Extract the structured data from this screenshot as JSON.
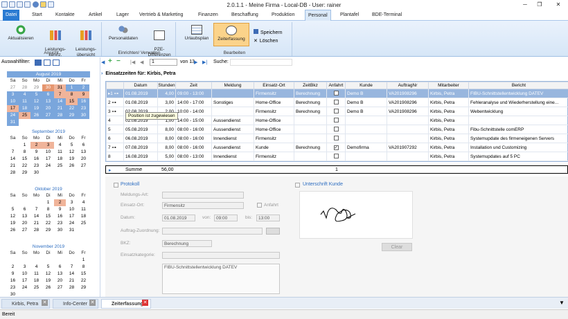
{
  "title_bar": {
    "title": "2.0.1.1 - Meine Firma - Local-DB - User: rainer",
    "minimize": "─",
    "restore": "❐",
    "close": "✕"
  },
  "menu": {
    "items": [
      "Datei",
      "Start",
      "Kontakte",
      "Artikel",
      "Lager",
      "Vertrieb & Marketing",
      "Finanzen",
      "Beschaffung",
      "Produktion",
      "Personal",
      "Plantafel",
      "BDE-Terminal"
    ],
    "active": "Personal"
  },
  "ribbon": {
    "groups": [
      {
        "label": "Ansicht",
        "buttons": [
          "Aktualisieren",
          "Leistungs-\nkennz.",
          "Leistungs-\nübersicht"
        ]
      },
      {
        "label": "Einrichten/ Verwalten",
        "buttons": [
          "Personaldaten",
          "PZE-\nDifferenzen"
        ]
      },
      {
        "label": "Bearbeiten",
        "buttons": [
          "Urlaubsplan",
          "Zeiterfassung"
        ]
      }
    ],
    "small_buttons": [
      "Speichern",
      "Löschen"
    ]
  },
  "filter": {
    "label": "Auswahlfilter:"
  },
  "calendars": [
    {
      "title": "August 2019",
      "weekdays": [
        "Sa",
        "So",
        "Mo",
        "Di",
        "Mi",
        "Do",
        "Fr"
      ],
      "days": [
        "27",
        "28",
        "29",
        "30",
        "31",
        "1",
        "2",
        "3",
        "4",
        "5",
        "6",
        "7",
        "8",
        "9",
        "10",
        "11",
        "12",
        "13",
        "14",
        "15",
        "16",
        "17",
        "18",
        "19",
        "20",
        "21",
        "22",
        "23",
        "24",
        "25",
        "26",
        "27",
        "28",
        "29",
        "30",
        "31"
      ]
    },
    {
      "title": "September 2019",
      "weekdays": [
        "Sa",
        "So",
        "Mo",
        "Di",
        "Mi",
        "Do",
        "Fr"
      ],
      "days": [
        "",
        "1",
        "2",
        "3",
        "4",
        "5",
        "6",
        "7",
        "8",
        "9",
        "10",
        "11",
        "12",
        "13",
        "14",
        "15",
        "16",
        "17",
        "18",
        "19",
        "20",
        "21",
        "22",
        "23",
        "24",
        "25",
        "26",
        "27",
        "28",
        "29",
        "30"
      ]
    },
    {
      "title": "Oktober 2019",
      "weekdays": [
        "Sa",
        "So",
        "Mo",
        "Di",
        "Mi",
        "Do",
        "Fr"
      ],
      "days": [
        "",
        "",
        "",
        "1",
        "2",
        "3",
        "4",
        "5",
        "6",
        "7",
        "8",
        "9",
        "10",
        "11",
        "12",
        "13",
        "14",
        "15",
        "16",
        "17",
        "18",
        "19",
        "20",
        "21",
        "22",
        "23",
        "24",
        "25",
        "26",
        "27",
        "28",
        "29",
        "30",
        "31"
      ]
    },
    {
      "title": "November 2019",
      "weekdays": [
        "Sa",
        "So",
        "Mo",
        "Di",
        "Mi",
        "Do",
        "Fr"
      ],
      "days": [
        "",
        "",
        "",
        "",
        "",
        "",
        "1",
        "2",
        "3",
        "4",
        "5",
        "6",
        "7",
        "8",
        "9",
        "10",
        "11",
        "12",
        "13",
        "14",
        "15",
        "16",
        "17",
        "18",
        "19",
        "20",
        "21",
        "22",
        "23",
        "24",
        "25",
        "26",
        "27",
        "28",
        "29",
        "30"
      ]
    }
  ],
  "navigator": {
    "position": "1",
    "of_label": "von 13",
    "search_label": "Suche:"
  },
  "grid": {
    "caption": "Einsatzzeiten für: Kirbis, Petra",
    "columns": [
      "Datum",
      "Stunden",
      "Zeit",
      "Meldung",
      "Einsatz-Ort",
      "ZeitBkz",
      "Anfahrt",
      "Kunde",
      "AuftragNr",
      "Mitarbeiter",
      "Bericht"
    ],
    "rows": [
      {
        "n": "1",
        "datum": "01.08.2019",
        "stunden": "4,00",
        "zeit": "09:00 - 13:00",
        "meldung": "",
        "ort": "Firmensitz",
        "bkz": "Berechnung",
        "anfahrt": "",
        "kunde": "Demo B",
        "auftrag": "VA201908296",
        "mitarbeiter": "Kirbis, Petra",
        "bericht": "FIBU-Schnittstellentwicklung DATEV"
      },
      {
        "n": "2",
        "datum": "01.08.2019",
        "stunden": "3,00",
        "zeit": "14:00 - 17:00",
        "meldung": "Sonstiges",
        "ort": "Home-Office",
        "bkz": "Berechnung",
        "anfahrt": "",
        "kunde": "Demo B",
        "auftrag": "VA201908296",
        "mitarbeiter": "Kirbis, Petra",
        "bericht": "Fehleranalyse und Wiederherstellung eine..."
      },
      {
        "n": "3",
        "datum": "02.08.2019",
        "stunden": "2,00",
        "zeit": "10:00 - 14:00",
        "meldung": "",
        "ort": "Firmensitz",
        "bkz": "Berechnung",
        "anfahrt": "",
        "kunde": "Demo B",
        "auftrag": "VA201908296",
        "mitarbeiter": "Kirbis, Petra",
        "bericht": "Webentwicklung"
      },
      {
        "n": "4",
        "datum": "02.08.2019",
        "stunden": "1,00",
        "zeit": "14:00 - 15:00",
        "meldung": "Aussendienst",
        "ort": "Home-Office",
        "bkz": "",
        "anfahrt": "",
        "kunde": "",
        "auftrag": "",
        "mitarbeiter": "Kirbis, Petra",
        "bericht": ""
      },
      {
        "n": "5",
        "datum": "05.08.2019",
        "stunden": "8,00",
        "zeit": "08:00 - 16:00",
        "meldung": "Aussendienst",
        "ort": "Home-Office",
        "bkz": "",
        "anfahrt": "",
        "kunde": "",
        "auftrag": "",
        "mitarbeiter": "Kirbis, Petra",
        "bericht": "Fibu-Schnittstelle comERP"
      },
      {
        "n": "6",
        "datum": "06.08.2019",
        "stunden": "8,00",
        "zeit": "08:00 - 16:00",
        "meldung": "Innendienst",
        "ort": "Firmensitz",
        "bkz": "",
        "anfahrt": "",
        "kunde": "",
        "auftrag": "",
        "mitarbeiter": "Kirbis, Petra",
        "bericht": "Systemupdate des firmeneigenen Servers"
      },
      {
        "n": "7",
        "datum": "07.08.2019",
        "stunden": "8,00",
        "zeit": "08:00 - 16:00",
        "meldung": "Aussendienst",
        "ort": "Kunde",
        "bkz": "Berechnung",
        "anfahrt": "✓",
        "kunde": "Demofirma",
        "auftrag": "VA201907292",
        "mitarbeiter": "Kirbis, Petra",
        "bericht": "Installation und Customizing"
      },
      {
        "n": "8",
        "datum": "16.08.2019",
        "stunden": "5,00",
        "zeit": "08:00 - 13:00",
        "meldung": "Innendienst",
        "ort": "Firmensitz",
        "bkz": "",
        "anfahrt": "",
        "kunde": "",
        "auftrag": "",
        "mitarbeiter": "Kirbis, Petra",
        "bericht": "Systemupdates auf 5 PC"
      }
    ],
    "tooltip": "Position ist zugewiesen",
    "sum_label": "Summe",
    "sum_hours": "56,00",
    "sum_count": "1"
  },
  "protokoll": {
    "title": "Protokoll",
    "meldungsart_label": "Meldungs-Art:",
    "einsatzort_label": "Einsatz-Ort:",
    "einsatzort_value": "Firmensitz",
    "anfahrt_label": "Anfahrt",
    "datum_label": "Datum:",
    "datum_value": "01.08.2019",
    "von_label": "von:",
    "von_value": "09:00",
    "bis_label": "bis:",
    "bis_value": "13:00",
    "auftrag_label": "Auftrag-Zuordnung:",
    "bkz_label": "BKZ:",
    "bkz_value": "Berechnung",
    "kategorie_label": "Einsatzkategorie:",
    "bericht_value": "FIBU-Schnittstellentwicklung DATEV"
  },
  "signature": {
    "title": "Unterschrift Kunde",
    "clear_label": "Clear"
  },
  "bottom_tabs": [
    {
      "label": "Kirbis, Petra"
    },
    {
      "label": "Info-Center"
    },
    {
      "label": "Zeiterfassung"
    }
  ],
  "status": {
    "text": "Bereit"
  }
}
